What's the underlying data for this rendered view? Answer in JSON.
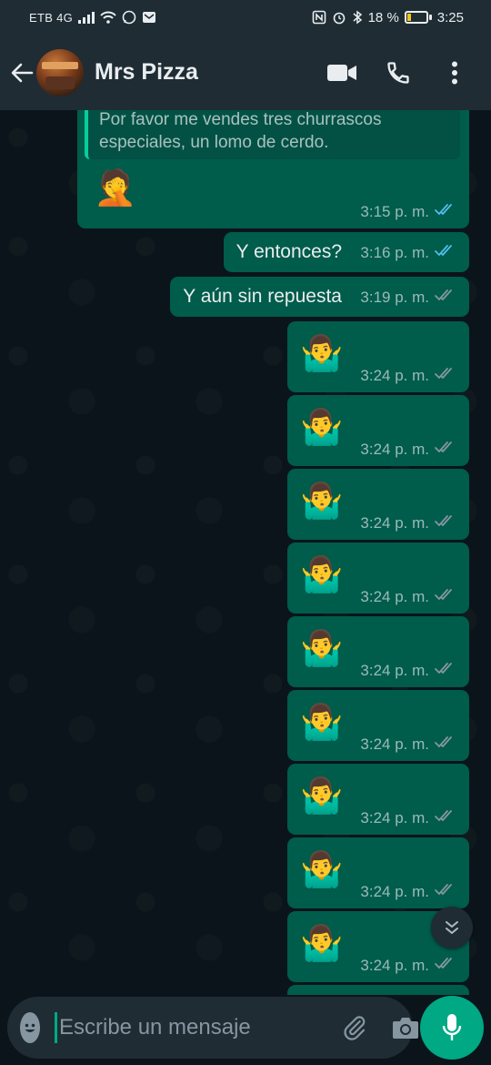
{
  "status_bar": {
    "carrier": "ETB 4G",
    "battery_percent": "18 %",
    "battery_level": 0.18,
    "time": "3:25",
    "icons": [
      "signal-icon",
      "wifi-icon",
      "whatsapp-notification-icon",
      "mail-icon",
      "nfc-icon",
      "alarm-icon",
      "bluetooth-icon",
      "battery-icon"
    ]
  },
  "header": {
    "contact_name": "Mrs Pizza",
    "icons": [
      "back-arrow-icon",
      "video-call-icon",
      "phone-icon",
      "more-vertical-icon"
    ]
  },
  "messages": [
    {
      "type": "quote",
      "quote_text": "Por favor me vendes tres churrascos especiales, un lomo de cerdo.",
      "emoji": "🤦",
      "time": "3:15 p. m.",
      "status": "read"
    },
    {
      "type": "text",
      "text": "Y entonces?",
      "time": "3:16 p. m.",
      "status": "read"
    },
    {
      "type": "text",
      "text": "Y aún sin repuesta",
      "time": "3:19 p. m.",
      "status": "delivered"
    },
    {
      "type": "emoji",
      "emoji": "🤷‍♂️",
      "time": "3:24 p. m.",
      "status": "delivered"
    },
    {
      "type": "emoji",
      "emoji": "🤷‍♂️",
      "time": "3:24 p. m.",
      "status": "delivered"
    },
    {
      "type": "emoji",
      "emoji": "🤷‍♂️",
      "time": "3:24 p. m.",
      "status": "delivered"
    },
    {
      "type": "emoji",
      "emoji": "🤷‍♂️",
      "time": "3:24 p. m.",
      "status": "delivered"
    },
    {
      "type": "emoji",
      "emoji": "🤷‍♂️",
      "time": "3:24 p. m.",
      "status": "delivered"
    },
    {
      "type": "emoji",
      "emoji": "🤷‍♂️",
      "time": "3:24 p. m.",
      "status": "delivered"
    },
    {
      "type": "emoji",
      "emoji": "🤷‍♂️",
      "time": "3:24 p. m.",
      "status": "delivered"
    },
    {
      "type": "emoji",
      "emoji": "🤷‍♂️",
      "time": "3:24 p. m.",
      "status": "delivered"
    },
    {
      "type": "emoji",
      "emoji": "🤷‍♂️",
      "time": "3:24 p. m.",
      "status": "delivered"
    }
  ],
  "composer": {
    "placeholder": "Escribe un mensaje",
    "value": "",
    "icons": [
      "emoji-icon",
      "attach-icon",
      "camera-icon",
      "mic-icon"
    ]
  },
  "colors": {
    "header_bg": "#1f2c34",
    "chat_bg": "#0b141a",
    "outgoing_bubble": "#005c4b",
    "read_tick": "#53bdeb",
    "delivered_tick": "#8696a0",
    "accent": "#00a884"
  }
}
